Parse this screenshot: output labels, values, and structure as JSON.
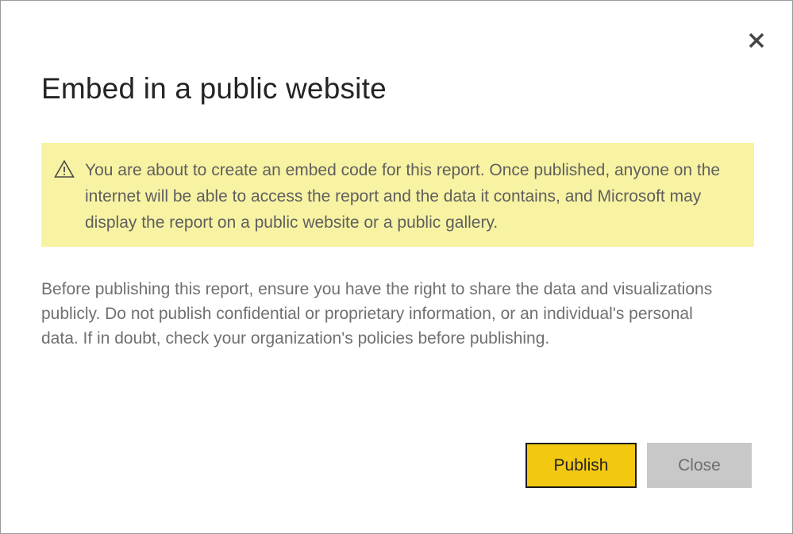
{
  "dialog": {
    "title": "Embed in a public website",
    "close_icon": "close-icon",
    "warning": {
      "icon": "warning-icon",
      "text": "You are about to create an embed code for this report. Once published, anyone on the internet will be able to access the report and the data it contains, and Microsoft may display the report on a public website or a public gallery."
    },
    "body_text": "Before publishing this report, ensure you have the right to share the data and visualizations publicly. Do not publish confidential or proprietary information, or an individual's personal data. If in doubt, check your organization's policies before publishing.",
    "buttons": {
      "publish_label": "Publish",
      "close_label": "Close"
    }
  },
  "colors": {
    "accent": "#f2c811",
    "warning_background": "#f8f3a3",
    "secondary_button": "#c8c8c8",
    "title_text": "#252423",
    "body_text": "#707070"
  }
}
